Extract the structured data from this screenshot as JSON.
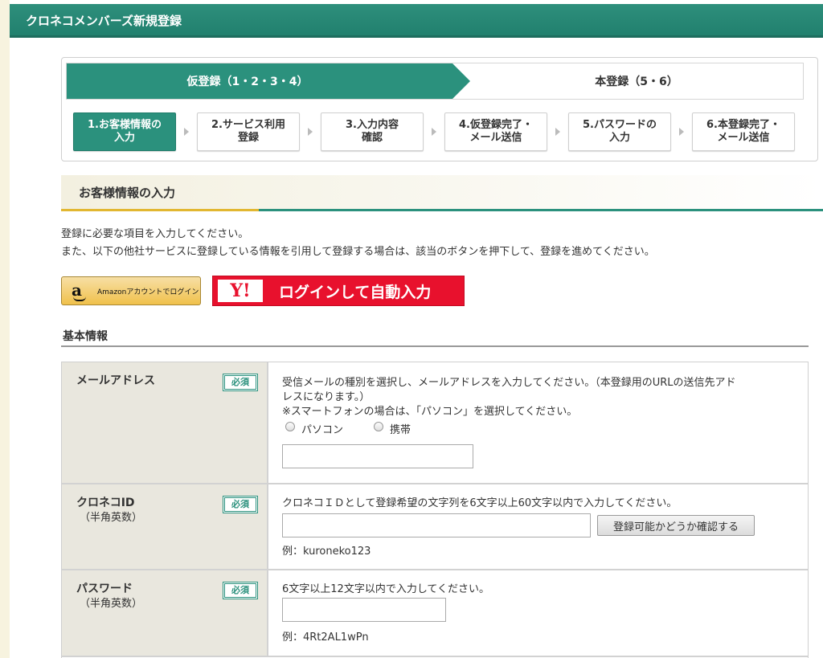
{
  "header": {
    "title": "クロネコメンバーズ新規登録"
  },
  "phases": {
    "active": "仮登録（1・2・3・4）",
    "next": "本登録（5・6）"
  },
  "steps": [
    {
      "line1": "1.お客様情報の",
      "line2": "入力"
    },
    {
      "line1": "2.サービス利用",
      "line2": "登録"
    },
    {
      "line1": "3.入力内容",
      "line2": "確認"
    },
    {
      "line1": "4.仮登録完了・",
      "line2": "メール送信"
    },
    {
      "line1": "5.パスワードの",
      "line2": "入力"
    },
    {
      "line1": "6.本登録完了・",
      "line2": "メール送信"
    }
  ],
  "section": {
    "title": "お客様情報の入力"
  },
  "intro": {
    "line1": "登録に必要な項目を入力してください。",
    "line2": "また、以下の他社サービスに登録している情報を引用して登録する場合は、該当のボタンを押下して、登録を進めてください。"
  },
  "social": {
    "amazon_logo": "a",
    "amazon_label": "Amazonアカウントでログイン",
    "yahoo_logo": "Y!",
    "yahoo_label": "ログインして自動入力"
  },
  "basic": {
    "title": "基本情報"
  },
  "required_label": "必須",
  "email": {
    "label": "メールアドレス",
    "desc1": "受信メールの種別を選択し、メールアドレスを入力してください。（本登録用のURLの送信先アド",
    "desc2": "レスになります。）",
    "desc3": "※スマートフォンの場合は、「パソコン」を選択してください。",
    "radio_pc": "パソコン",
    "radio_mobile": "携帯",
    "value": ""
  },
  "kuroneko_id": {
    "label": "クロネコID",
    "sub": "（半角英数）",
    "desc": "クロネコＩＤとして登録希望の文字列を6文字以上60文字以内で入力してください。",
    "check_button": "登録可能かどうか確認する",
    "example": "例：kuroneko123",
    "value": ""
  },
  "password": {
    "label": "パスワード",
    "sub": "（半角英数）",
    "desc": "6文字以上12文字以内で入力してください。",
    "example": "例：4Rt2AL1wPn",
    "value": ""
  }
}
